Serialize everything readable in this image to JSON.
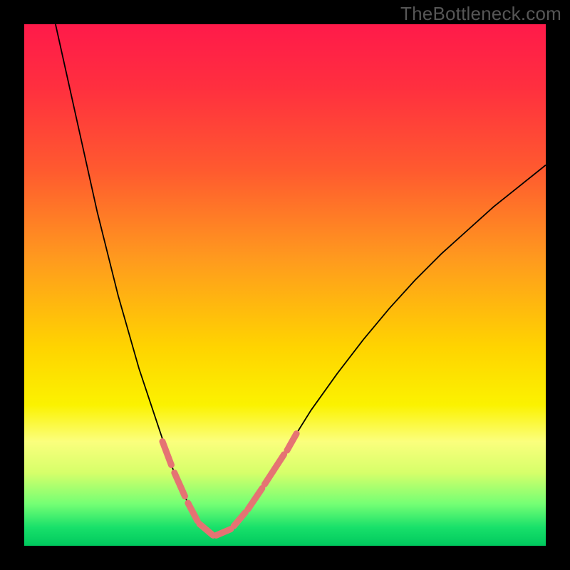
{
  "watermark": "TheBottleneck.com",
  "chart_data": {
    "type": "line",
    "title": "",
    "xlabel": "",
    "ylabel": "",
    "xlim": [
      0,
      100
    ],
    "ylim": [
      0,
      100
    ],
    "background_gradient": {
      "type": "linear-vertical",
      "stops": [
        {
          "pos": 0.0,
          "color": "#ff1a4a"
        },
        {
          "pos": 0.12,
          "color": "#ff2f3f"
        },
        {
          "pos": 0.28,
          "color": "#ff5a2f"
        },
        {
          "pos": 0.45,
          "color": "#ff9a1e"
        },
        {
          "pos": 0.62,
          "color": "#ffd400"
        },
        {
          "pos": 0.73,
          "color": "#fbf200"
        },
        {
          "pos": 0.8,
          "color": "#fbff7d"
        },
        {
          "pos": 0.86,
          "color": "#d6ff6a"
        },
        {
          "pos": 0.92,
          "color": "#74ff74"
        },
        {
          "pos": 0.965,
          "color": "#18e06a"
        },
        {
          "pos": 1.0,
          "color": "#00c95e"
        }
      ]
    },
    "series": [
      {
        "name": "bottleneck-curve",
        "stroke": "#000000",
        "stroke_width": 1.8,
        "x": [
          6,
          8,
          10,
          12,
          14,
          16,
          18,
          20,
          22,
          24,
          26,
          28,
          30,
          32,
          33,
          34,
          35,
          36,
          38,
          40,
          42,
          45,
          50,
          55,
          60,
          65,
          70,
          75,
          80,
          85,
          90,
          95,
          100
        ],
        "y": [
          100,
          91,
          82,
          73,
          64,
          56,
          48,
          41,
          34,
          28,
          22,
          16,
          11,
          7,
          5,
          3.5,
          2.5,
          2,
          2.2,
          3.5,
          6,
          10,
          18,
          26,
          33,
          39.5,
          45.5,
          51,
          56,
          60.5,
          65,
          69,
          73
        ]
      },
      {
        "name": "highlight-segments",
        "stroke": "#e57373",
        "stroke_width": 9,
        "stroke_linecap": "round",
        "segments": [
          {
            "x": [
              26.5,
              28.2
            ],
            "y": [
              20,
              15.5
            ]
          },
          {
            "x": [
              28.8,
              30.8
            ],
            "y": [
              14,
              9.5
            ]
          },
          {
            "x": [
              31.4,
              33.2
            ],
            "y": [
              8.2,
              4.8
            ]
          },
          {
            "x": [
              33.6,
              36.2
            ],
            "y": [
              4.2,
              2.0
            ]
          },
          {
            "x": [
              36.8,
              39.6
            ],
            "y": [
              2.0,
              3.2
            ]
          },
          {
            "x": [
              40.2,
              42.4
            ],
            "y": [
              3.8,
              6.4
            ]
          },
          {
            "x": [
              42.9,
              45.6
            ],
            "y": [
              7.0,
              11.0
            ]
          },
          {
            "x": [
              46.1,
              49.8
            ],
            "y": [
              11.8,
              17.5
            ]
          },
          {
            "x": [
              50.4,
              52.2
            ],
            "y": [
              18.3,
              21.5
            ]
          }
        ]
      }
    ]
  }
}
